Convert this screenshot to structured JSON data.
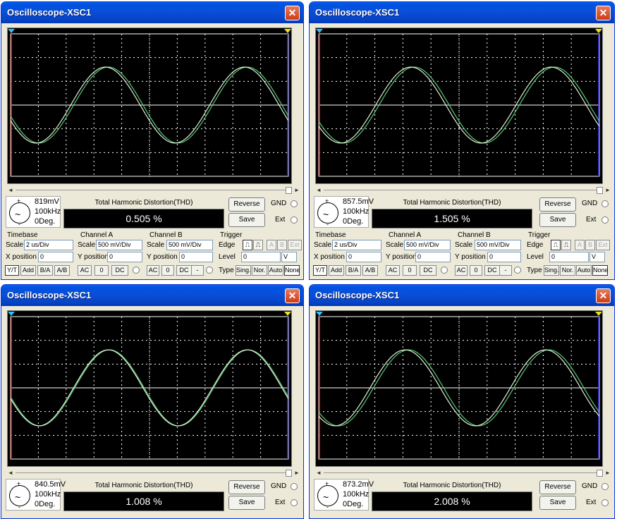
{
  "windows": [
    {
      "title": "Oscilloscope-XSC1",
      "probe": {
        "voltage": "819mV",
        "frequency": "100kHz",
        "phase": "0Deg."
      },
      "thd": "0.505 %",
      "controls": true
    },
    {
      "title": "Oscilloscope-XSC1",
      "probe": {
        "voltage": "857.5mV",
        "frequency": "100kHz",
        "phase": "0Deg."
      },
      "thd": "1.505 %",
      "controls": true
    },
    {
      "title": "Oscilloscope-XSC1",
      "probe": {
        "voltage": "840.5mV",
        "frequency": "100kHz",
        "phase": "0Deg."
      },
      "thd": "1.008 %",
      "controls": false
    },
    {
      "title": "Oscilloscope-XSC1",
      "probe": {
        "voltage": "873.2mV",
        "frequency": "100kHz",
        "phase": "0Deg."
      },
      "thd": "2.008 %",
      "controls": false
    }
  ],
  "labels": {
    "close": "✕",
    "thd_label": "Total Harmonic Distortion(THD)",
    "reverse": "Reverse",
    "save": "Save",
    "gnd": "GND",
    "ext": "Ext",
    "plus": "+",
    "minus": "-",
    "wave": "~",
    "timebase": "Timebase",
    "channel_a": "Channel A",
    "channel_b": "Channel B",
    "trigger": "Trigger",
    "scale": "Scale",
    "x_position": "X position",
    "y_position": "Y position",
    "edge": "Edge",
    "level": "Level",
    "type": "Type"
  },
  "settings": {
    "timebase_scale": "2 us/Div",
    "x_position": "0",
    "cha_scale": "500 mV/Div",
    "cha_ypos": "0",
    "chb_scale": "500 mV/Div",
    "chb_ypos": "0",
    "trigger_level": "0",
    "trigger_level_unit": "V",
    "display_modes": [
      "Y/T",
      "Add",
      "B/A",
      "A/B"
    ],
    "coupling": [
      "AC",
      "0",
      "DC",
      "-"
    ],
    "trigger_edge_buttons": [
      "A",
      "B",
      "Ext"
    ],
    "trigger_types": [
      "Sing.",
      "Nor.",
      "Auto",
      "None"
    ]
  },
  "colors": {
    "trace_a": "#55cc77",
    "trace_b": "#e8f0d8",
    "grid": "#ffffff",
    "cursor1": "#e03030",
    "cursor2": "#3030e0",
    "cursor1_marker": "#2fc0ff",
    "cursor2_marker": "#e8e020"
  }
}
